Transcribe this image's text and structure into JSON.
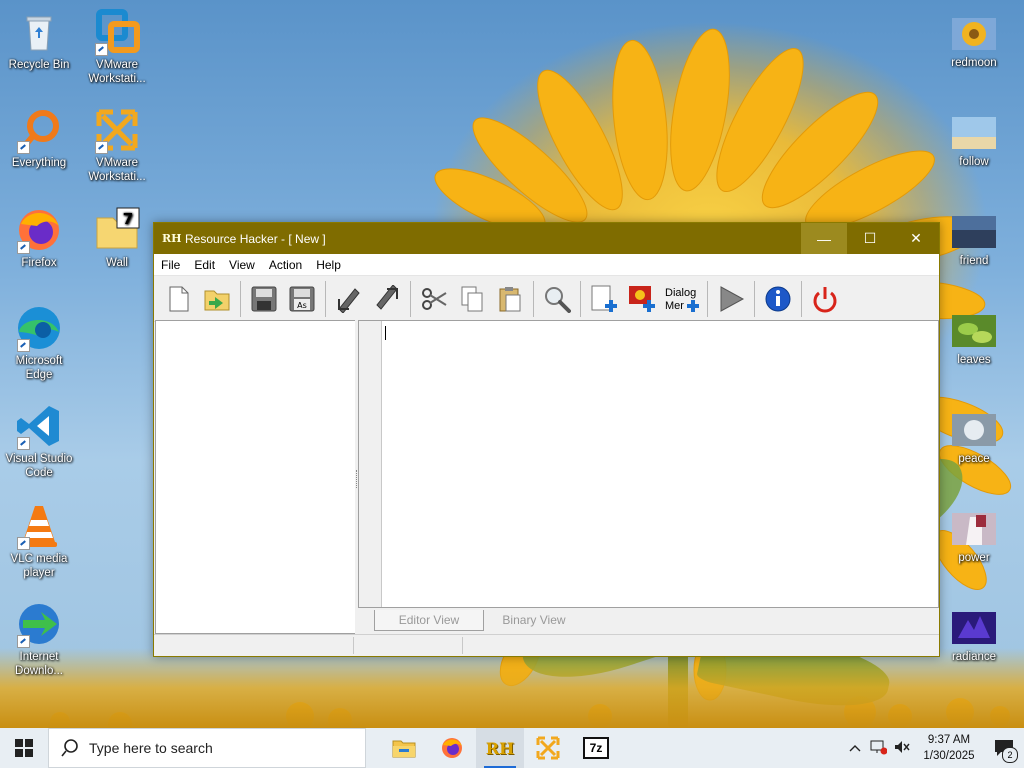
{
  "desktop": {
    "left_icons": [
      {
        "label": "Recycle Bin",
        "icon": "recycle-bin-icon"
      },
      {
        "label": "VMware Workstati...",
        "icon": "vmware-icon"
      },
      {
        "label": "Everything",
        "icon": "everything-search-icon"
      },
      {
        "label": "VMware Workstati...",
        "icon": "vmware-icon"
      },
      {
        "label": "Firefox",
        "icon": "firefox-icon"
      },
      {
        "label": "Wall",
        "icon": "folder-7zip-icon"
      },
      {
        "label": "Microsoft Edge",
        "icon": "edge-icon"
      },
      {
        "label": "Visual Studio Code",
        "icon": "vscode-icon"
      },
      {
        "label": "VLC media player",
        "icon": "vlc-icon"
      },
      {
        "label": "Internet Downlo...",
        "icon": "idm-icon"
      }
    ],
    "right_icons": [
      {
        "label": "redmoon",
        "icon": "image-file-icon"
      },
      {
        "label": "follow",
        "icon": "image-file-icon"
      },
      {
        "label": "friend",
        "icon": "image-file-icon"
      },
      {
        "label": "leaves",
        "icon": "image-file-icon"
      },
      {
        "label": "peace",
        "icon": "image-file-icon"
      },
      {
        "label": "power",
        "icon": "image-file-icon"
      },
      {
        "label": "radiance",
        "icon": "image-file-icon"
      }
    ]
  },
  "window": {
    "app_icon_text": "RH",
    "title": "Resource Hacker - [ New ]",
    "controls": {
      "minimize": "—",
      "maximize": "☐",
      "close": "✕"
    },
    "menu": [
      "File",
      "Edit",
      "View",
      "Action",
      "Help"
    ],
    "toolbar": {
      "dialog_menu_label_1": "Dialog",
      "dialog_menu_label_2": "Mer"
    },
    "tabs": {
      "editor": "Editor View",
      "binary": "Binary View"
    }
  },
  "taskbar": {
    "search_placeholder": "Type here to search",
    "time": "9:37 AM",
    "date": "1/30/2025",
    "notification_count": "2",
    "rh_label": "RH",
    "sevenzip_label": "7z"
  },
  "colors": {
    "titlebar": "#7f6c00",
    "taskbar": "#e8eef3",
    "accent": "#1e6bd6"
  }
}
